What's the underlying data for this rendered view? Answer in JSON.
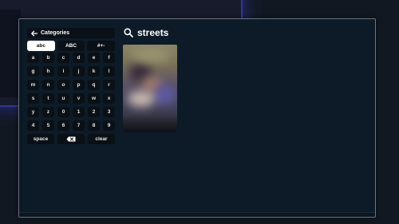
{
  "categories_button": {
    "label": "Categories",
    "icon": "arrow-left-icon"
  },
  "keyboard": {
    "modes": [
      {
        "label": "abc",
        "active": true
      },
      {
        "label": "ABC",
        "active": false
      },
      {
        "label": "#+-",
        "active": false
      }
    ],
    "keys": [
      "a",
      "b",
      "c",
      "d",
      "e",
      "f",
      "g",
      "h",
      "i",
      "j",
      "k",
      "l",
      "m",
      "n",
      "o",
      "p",
      "q",
      "r",
      "s",
      "t",
      "u",
      "v",
      "w",
      "x",
      "y",
      "z",
      "0",
      "1",
      "2",
      "3",
      "4",
      "5",
      "6",
      "7",
      "8",
      "9"
    ],
    "space_label": "space",
    "backspace_icon": "backspace-icon",
    "clear_label": "clear"
  },
  "search": {
    "icon": "search-icon",
    "query": "streets"
  },
  "results": [
    {
      "kind": "video-thumbnail",
      "blurred": true
    }
  ],
  "colors": {
    "screen_background": "#0d1b28",
    "key_background": "#0a1015",
    "active_mode_background": "#ffffff",
    "accent_glow": "#34359a"
  }
}
